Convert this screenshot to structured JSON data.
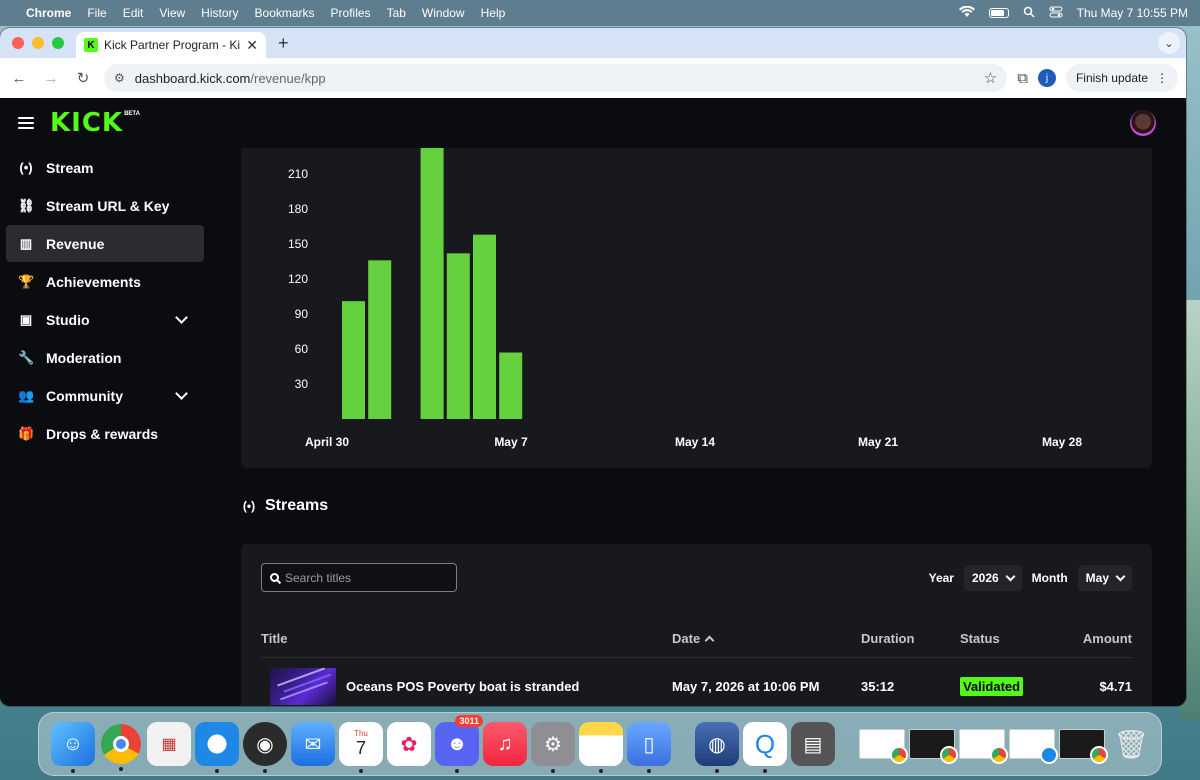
{
  "menubar": {
    "app": "Chrome",
    "items": [
      "File",
      "Edit",
      "View",
      "History",
      "Bookmarks",
      "Profiles",
      "Tab",
      "Window",
      "Help"
    ],
    "datetime": "Thu May 7  10:55 PM"
  },
  "browser": {
    "tab_title": "Kick Partner Program - Kick D",
    "url_host": "dashboard.kick.com",
    "url_path": "/revenue/kpp",
    "profile_initial": "j",
    "finish_update": "Finish update"
  },
  "kick": {
    "logo": "KICK",
    "beta": "BETA",
    "sidebar": [
      {
        "label": "Stream",
        "icon": "broadcast-icon",
        "glyph": "(•)"
      },
      {
        "label": "Stream URL & Key",
        "icon": "link-icon",
        "glyph": "⛓"
      },
      {
        "label": "Revenue",
        "icon": "bar-chart-icon",
        "glyph": "▥"
      },
      {
        "label": "Achievements",
        "icon": "trophy-icon",
        "glyph": "🏆"
      },
      {
        "label": "Studio",
        "icon": "studio-icon",
        "glyph": "▣"
      },
      {
        "label": "Moderation",
        "icon": "wrench-icon",
        "glyph": "🔧"
      },
      {
        "label": "Community",
        "icon": "people-icon",
        "glyph": "👥"
      },
      {
        "label": "Drops & rewards",
        "icon": "gift-icon",
        "glyph": "🎁"
      }
    ],
    "streams_title": "Streams",
    "search_placeholder": "Search titles",
    "filters": {
      "year_label": "Year",
      "year_value": "2026",
      "month_label": "Month",
      "month_value": "May"
    },
    "table": {
      "headers": {
        "title": "Title",
        "date": "Date",
        "duration": "Duration",
        "status": "Status",
        "amount": "Amount"
      },
      "rows": [
        {
          "title": "Oceans POS Poverty boat is stranded",
          "date": "May 7, 2026 at 10:06 PM",
          "duration": "35:12",
          "status": "Validated",
          "amount": "$4.71"
        }
      ]
    }
  },
  "chart_data": {
    "type": "bar",
    "y_ticks": [
      30,
      60,
      90,
      120,
      150,
      180,
      210
    ],
    "x_tick_labels": [
      "April 30",
      "May 7",
      "May 14",
      "May 21",
      "May 28"
    ],
    "bars": [
      {
        "day_offset": 0,
        "value": 101
      },
      {
        "day_offset": 1,
        "value": 136
      },
      {
        "day_offset": 3,
        "value": 240
      },
      {
        "day_offset": 4,
        "value": 142
      },
      {
        "day_offset": 5,
        "value": 158
      },
      {
        "day_offset": 6,
        "value": 57
      }
    ],
    "bar_color": "#66d13f",
    "ylim": [
      0,
      240
    ]
  },
  "dock": {
    "discord_badge": "3011",
    "calendar_day": "Thu",
    "calendar_date": "7"
  }
}
